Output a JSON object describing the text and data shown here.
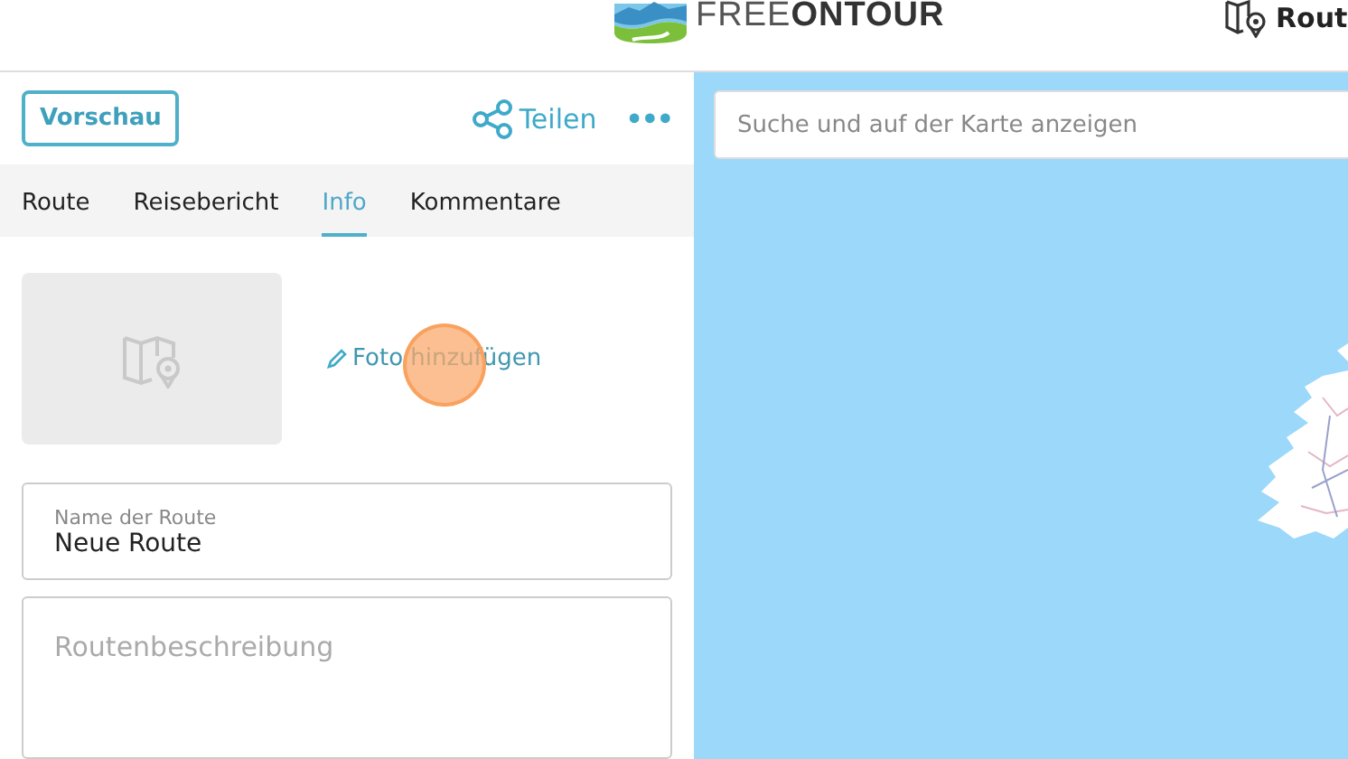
{
  "header": {
    "logo": "FREE**ONTOUR**",
    "nav_link": "Rout"
  },
  "toolbar": {
    "preview_button": "Vorschau",
    "share_button": "Teilen",
    "more_button": "•••"
  },
  "tabs": [
    {
      "label": "Route",
      "selected": false
    },
    {
      "label": "Reisebericht",
      "selected": false
    },
    {
      "label": "Info",
      "selected": true
    },
    {
      "label": "Kommentare",
      "selected": false
    }
  ],
  "photo": {
    "add_link": "Foto hinzufügen"
  },
  "name_field": {
    "label": "Name der Route",
    "value": "Neue Route"
  },
  "description_field": {
    "placeholder": "Routenbeschreibung"
  },
  "map": {
    "search": {
      "placeholder": "Suche und auf der Karte anzeigen"
    }
  }
}
